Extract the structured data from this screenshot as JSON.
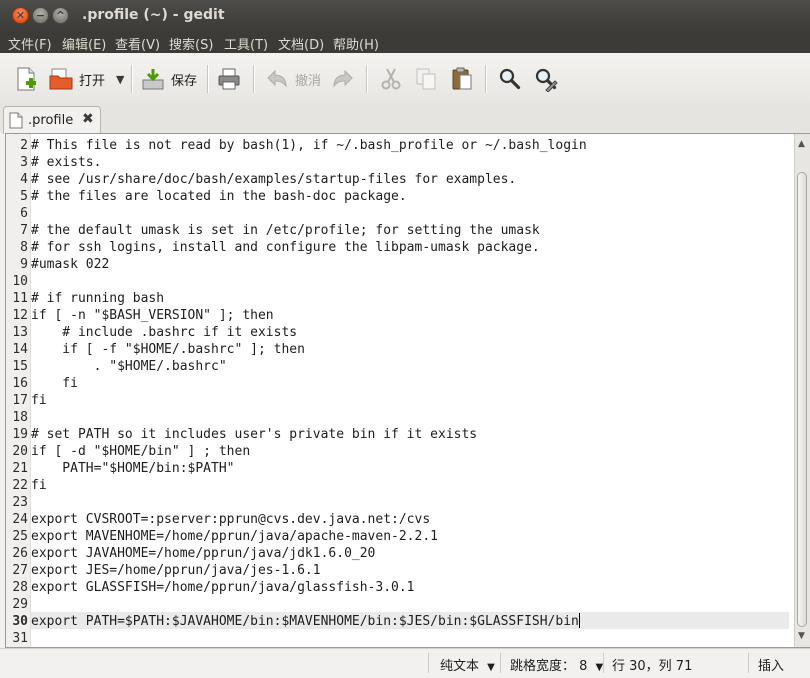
{
  "window": {
    "title": ".profile (~) - gedit",
    "close_glyph": "✕",
    "min_glyph": "−",
    "max_glyph": "^"
  },
  "menu": [
    "文件(F)",
    "编辑(E)",
    "查看(V)",
    "搜索(S)",
    "工具(T)",
    "文档(D)",
    "帮助(H)"
  ],
  "toolbar": {
    "open_label": "打开",
    "save_label": "保存",
    "undo_label": "撤消",
    "open_menu_glyph": "▼"
  },
  "tab": {
    "label": ".profile",
    "close_glyph": "✖"
  },
  "editor": {
    "current_line": 30,
    "lines": [
      {
        "n": "2",
        "text": "# This file is not read by bash(1), if ~/.bash_profile or ~/.bash_login"
      },
      {
        "n": "3",
        "text": "# exists."
      },
      {
        "n": "4",
        "text": "# see /usr/share/doc/bash/examples/startup-files for examples."
      },
      {
        "n": "5",
        "text": "# the files are located in the bash-doc package."
      },
      {
        "n": "6",
        "text": ""
      },
      {
        "n": "7",
        "text": "# the default umask is set in /etc/profile; for setting the umask"
      },
      {
        "n": "8",
        "text": "# for ssh logins, install and configure the libpam-umask package."
      },
      {
        "n": "9",
        "text": "#umask 022"
      },
      {
        "n": "10",
        "text": ""
      },
      {
        "n": "11",
        "text": "# if running bash"
      },
      {
        "n": "12",
        "text": "if [ -n \"$BASH_VERSION\" ]; then"
      },
      {
        "n": "13",
        "text": "    # include .bashrc if it exists"
      },
      {
        "n": "14",
        "text": "    if [ -f \"$HOME/.bashrc\" ]; then"
      },
      {
        "n": "15",
        "text": "        . \"$HOME/.bashrc\""
      },
      {
        "n": "16",
        "text": "    fi"
      },
      {
        "n": "17",
        "text": "fi"
      },
      {
        "n": "18",
        "text": ""
      },
      {
        "n": "19",
        "text": "# set PATH so it includes user's private bin if it exists"
      },
      {
        "n": "20",
        "text": "if [ -d \"$HOME/bin\" ] ; then"
      },
      {
        "n": "21",
        "text": "    PATH=\"$HOME/bin:$PATH\""
      },
      {
        "n": "22",
        "text": "fi"
      },
      {
        "n": "23",
        "text": ""
      },
      {
        "n": "24",
        "text": "export CVSROOT=:pserver:pprun@cvs.dev.java.net:/cvs"
      },
      {
        "n": "25",
        "text": "export MAVENHOME=/home/pprun/java/apache-maven-2.2.1"
      },
      {
        "n": "26",
        "text": "export JAVAHOME=/home/pprun/java/jdk1.6.0_20"
      },
      {
        "n": "27",
        "text": "export JES=/home/pprun/java/jes-1.6.1"
      },
      {
        "n": "28",
        "text": "export GLASSFISH=/home/pprun/java/glassfish-3.0.1"
      },
      {
        "n": "29",
        "text": ""
      },
      {
        "n": "30",
        "text": "export PATH=$PATH:$JAVAHOME/bin:$MAVENHOME/bin:$JES/bin:$GLASSFISH/bin"
      },
      {
        "n": "31",
        "text": ""
      }
    ]
  },
  "scroll_arrows": {
    "up": "▲",
    "down": "▼"
  },
  "status": {
    "syntax": "纯文本",
    "tab_width": "跳格宽度： 8",
    "position": "行 30，列 71",
    "mode": "插入",
    "dropdown_glyph": "▼"
  },
  "colors": {
    "titlebar": "#3c3b37",
    "close_button": "#e2541b",
    "menu_text": "#dfdbd2",
    "current_line_bg": "#eaeaea"
  }
}
